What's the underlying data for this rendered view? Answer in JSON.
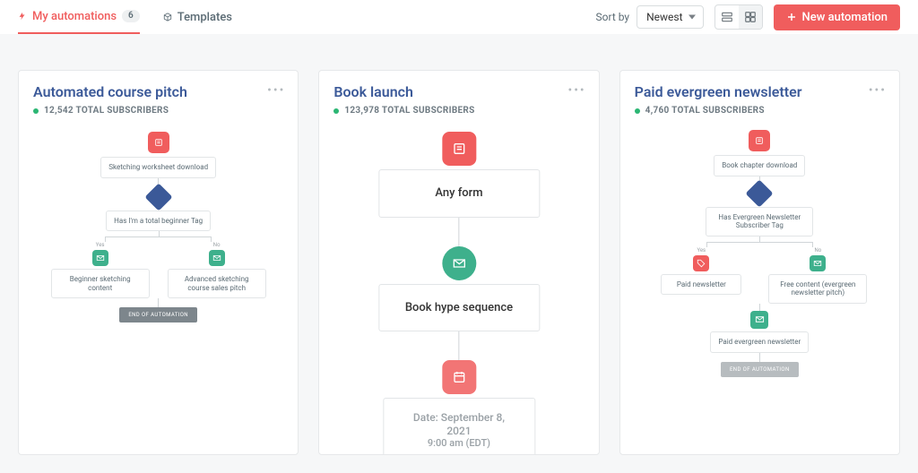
{
  "tabs": {
    "my_automations": "My automations",
    "count": "6",
    "templates": "Templates"
  },
  "sort": {
    "label": "Sort by",
    "value": "Newest"
  },
  "new_button": "New automation",
  "cards": [
    {
      "title": "Automated course pitch",
      "subs": "12,542 TOTAL SUBSCRIBERS",
      "n1": "Sketching worksheet download",
      "n2": "Has I'm a total beginner Tag",
      "yes": "Yes",
      "no": "No",
      "left": "Beginner sketching content",
      "right": "Advanced sketching course sales pitch",
      "end": "END OF AUTOMATION"
    },
    {
      "title": "Book launch",
      "subs": "123,978 TOTAL SUBSCRIBERS",
      "n1": "Any form",
      "n2": "Book hype sequence",
      "n3a": "Date: September 8, 2021",
      "n3b": "9:00 am (EDT)"
    },
    {
      "title": "Paid evergreen newsletter",
      "subs": "4,760 TOTAL SUBSCRIBERS",
      "n1": "Book chapter download",
      "n2": "Has Evergreen Newsletter Subscriber Tag",
      "yes": "Yes",
      "no": "No",
      "left": "Paid newsletter",
      "right": "Free content (evergreen newsletter pitch)",
      "mid": "Paid evergreen newsletter",
      "end": "END OF AUTOMATION"
    }
  ]
}
